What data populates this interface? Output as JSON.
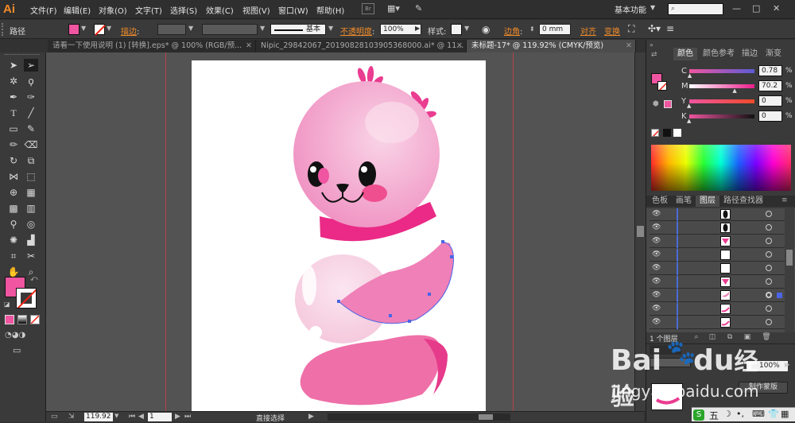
{
  "app": {
    "logo": "Ai",
    "menu": [
      "文件(F)",
      "编辑(E)",
      "对象(O)",
      "文字(T)",
      "选择(S)",
      "效果(C)",
      "视图(V)",
      "窗口(W)",
      "帮助(H)"
    ],
    "bridge_label": "Br",
    "workspace": "基本功能",
    "search_placeholder": "",
    "window_buttons": [
      "—",
      "□",
      "✕"
    ]
  },
  "control_bar": {
    "object_type": "路径",
    "stroke_label": "描边",
    "stroke_style": "基本",
    "opacity_label": "不透明度",
    "opacity_value": "100%",
    "style_label": "样式",
    "corner_label": "边角",
    "corner_value": "0 mm",
    "align_label": "对齐",
    "transform_label": "变换",
    "fill_color": "#ef55a0"
  },
  "tabs": [
    {
      "label": "请看一下使用说明 (1) [转换].eps* @ 100% (RGB/预...",
      "close": "✕",
      "active": false
    },
    {
      "label": "Nipic_29842067_20190828103905368000.ai* @ 11...",
      "close": "✕",
      "active": false
    },
    {
      "label": "未标题-17* @ 119.92% (CMYK/预览)",
      "close": "✕",
      "active": true
    }
  ],
  "status": {
    "zoom": "119.92",
    "page": "1",
    "tool_name": "直接选择"
  },
  "color_panel": {
    "tabs": [
      "颜色",
      "颜色参考",
      "描边",
      "渐变"
    ],
    "channels": [
      {
        "label": "C",
        "value": "0.78",
        "pct": "%",
        "level": 0.01
      },
      {
        "label": "M",
        "value": "70.2",
        "pct": "%",
        "level": 0.7
      },
      {
        "label": "Y",
        "value": "0",
        "pct": "%",
        "level": 0.0
      },
      {
        "label": "K",
        "value": "0",
        "pct": "%",
        "level": 0.0
      }
    ],
    "current_color": "#ef55a0"
  },
  "layers_panel": {
    "tabs": [
      "色板",
      "画笔",
      "图层",
      "路径查找器"
    ],
    "layer_count_label": "1 个图层",
    "rows": [
      {
        "thumb": "black-pill"
      },
      {
        "thumb": "black-pill"
      },
      {
        "thumb": "pink-fan"
      },
      {
        "thumb": "blank"
      },
      {
        "thumb": "blank"
      },
      {
        "thumb": "pink-fan"
      },
      {
        "thumb": "pink-shape"
      },
      {
        "thumb": "pink-stroke"
      },
      {
        "thumb": "pink-stroke"
      }
    ]
  },
  "transparency_panel": {
    "value": "100%",
    "button": "制作蒙版"
  },
  "watermark": {
    "brand": "Bai",
    "brand2": "du",
    "brand_suffix": "经验",
    "url": "jingyan.baidu.com"
  },
  "taskbar": {
    "ime": "五"
  }
}
